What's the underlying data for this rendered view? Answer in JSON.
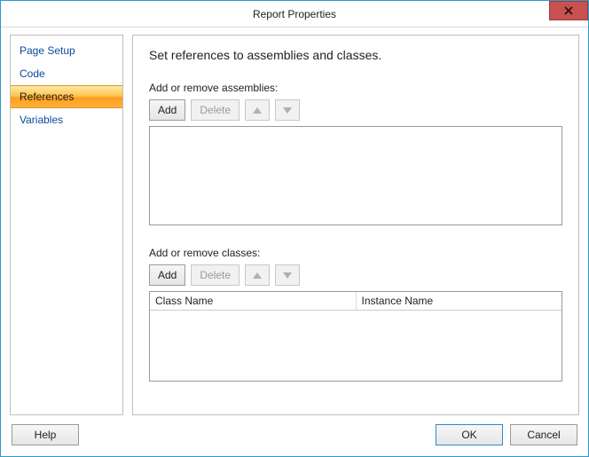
{
  "window": {
    "title": "Report Properties",
    "close_tooltip": "Close"
  },
  "sidebar": {
    "items": [
      {
        "label": "Page Setup",
        "selected": false
      },
      {
        "label": "Code",
        "selected": false
      },
      {
        "label": "References",
        "selected": true
      },
      {
        "label": "Variables",
        "selected": false
      }
    ]
  },
  "content": {
    "heading": "Set references to assemblies and classes.",
    "assemblies": {
      "label": "Add or remove assemblies:",
      "add": "Add",
      "delete": "Delete"
    },
    "classes": {
      "label": "Add or remove classes:",
      "add": "Add",
      "delete": "Delete",
      "columns": {
        "class_name": "Class Name",
        "instance_name": "Instance Name"
      }
    }
  },
  "footer": {
    "help": "Help",
    "ok": "OK",
    "cancel": "Cancel"
  }
}
